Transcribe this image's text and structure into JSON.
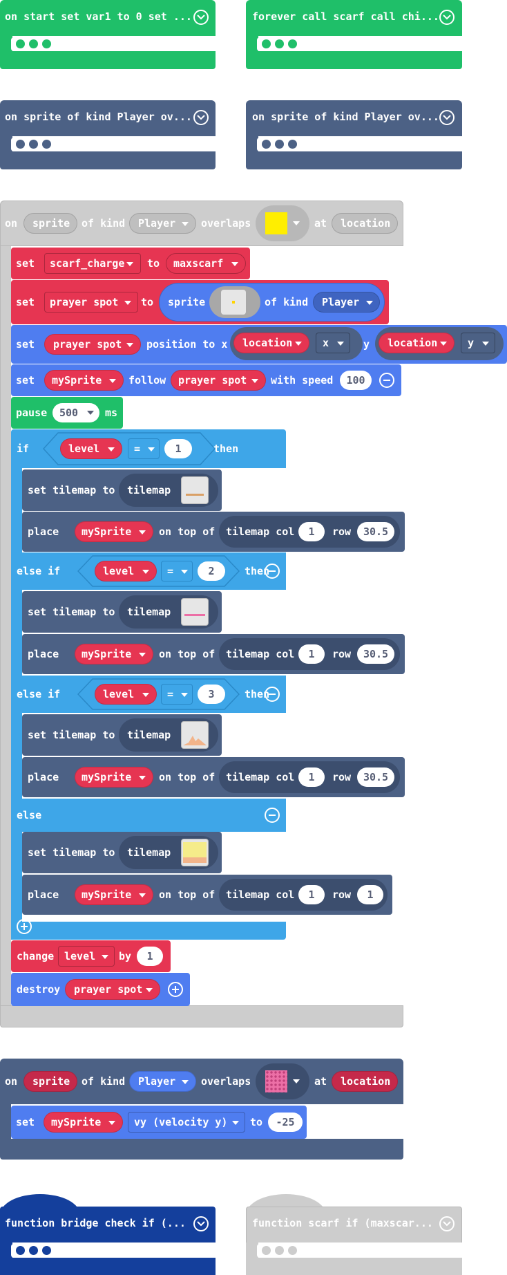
{
  "colors": {
    "green": "#1fbf69",
    "dark": "#4c6185",
    "red": "#e63552",
    "blue": "#4f7df0",
    "lightblue": "#3ea6e8",
    "gray": "#cdcdcd",
    "navy": "#143f9c"
  },
  "collapsed": {
    "on_start": "on start set var1 to 0 set ...",
    "forever": "forever call scarf call chi...",
    "overlap1": "on sprite of kind Player ov...",
    "overlap2": "on sprite of kind Player ov...",
    "bridge": "function bridge check  if (...",
    "scarf": "function scarf  if (maxscar..."
  },
  "event1": {
    "on": "on",
    "sprite": "sprite",
    "of_kind": "of kind",
    "player": "Player",
    "overlaps": "overlaps",
    "at": "at",
    "location": "location",
    "tile_color": "#ffee00"
  },
  "stmts": {
    "set": "set",
    "to": "to",
    "scarf_charge": "scarf_charge",
    "maxscarf": "maxscarf",
    "prayer_spot": "prayer spot",
    "sprite": "sprite",
    "of_kind": "of kind",
    "player": "Player",
    "position_to_x": "position to x",
    "location": "location",
    "x": "x",
    "y": "y",
    "mySprite": "mySprite",
    "follow": "follow",
    "with_speed": "with speed",
    "speed": "100",
    "pause": "pause",
    "ms_value": "500",
    "ms": "ms"
  },
  "ifblock": {
    "if": "if",
    "else_if": "else if",
    "else": "else",
    "then": "then",
    "level": "level",
    "eq": "=",
    "set_tilemap_to": "set tilemap to",
    "tilemap": "tilemap",
    "place": "place",
    "mySprite": "mySprite",
    "on_top_of": "on top of",
    "tilemap_col": "tilemap col",
    "row": "row",
    "branches": [
      {
        "value": "1",
        "col": "1",
        "row": "30.5"
      },
      {
        "value": "2",
        "col": "1",
        "row": "30.5"
      },
      {
        "value": "3",
        "col": "1",
        "row": "30.5"
      },
      {
        "col": "1",
        "row": "1"
      }
    ]
  },
  "tail": {
    "change": "change",
    "level": "level",
    "by": "by",
    "amount": "1",
    "destroy": "destroy",
    "prayer_spot": "prayer spot"
  },
  "event2": {
    "on": "on",
    "sprite": "sprite",
    "of_kind": "of kind",
    "player": "Player",
    "overlaps": "overlaps",
    "at": "at",
    "location": "location",
    "set": "set",
    "mySprite": "mySprite",
    "vy": "vy (velocity y)",
    "to": "to",
    "value": "-25"
  }
}
